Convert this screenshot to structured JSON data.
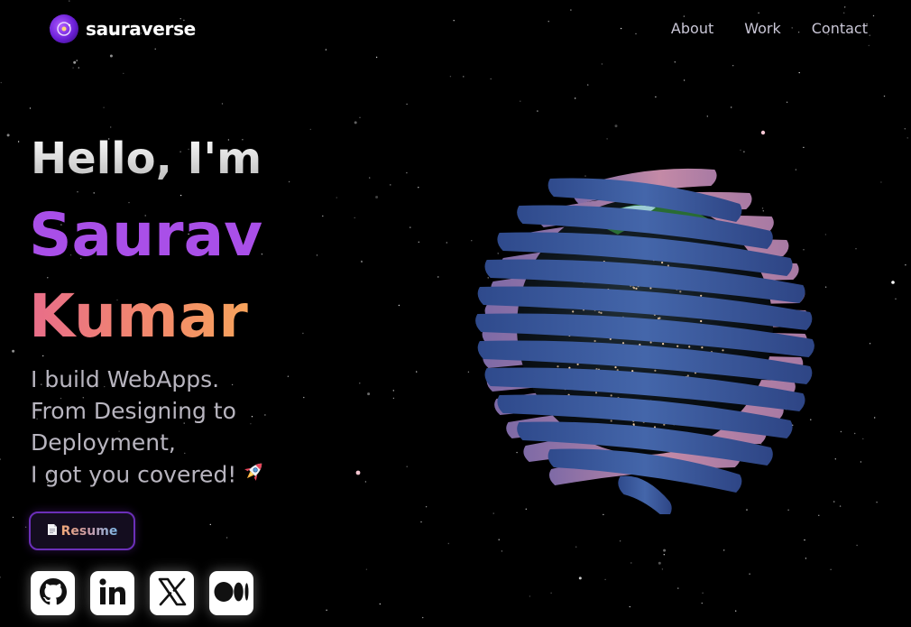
{
  "brand": {
    "name": "sauraverse"
  },
  "nav": {
    "links": [
      "About",
      "Work",
      "Contact"
    ]
  },
  "hero": {
    "greeting": "Hello, I'm",
    "first_name": "Saurav",
    "last_name": "Kumar",
    "tagline": [
      "I build WebApps.",
      "From Designing to",
      "Deployment,",
      "I got you covered!"
    ]
  },
  "resume": {
    "label": "Resume"
  },
  "social_icons": [
    "github-icon",
    "linkedin-icon",
    "x-icon",
    "medium-icon"
  ],
  "colors": {
    "background": "#000000",
    "accent_purple": "#a94fe8",
    "accent_orange": "#f7a35c",
    "planet_bands": "#3a5aa0"
  }
}
